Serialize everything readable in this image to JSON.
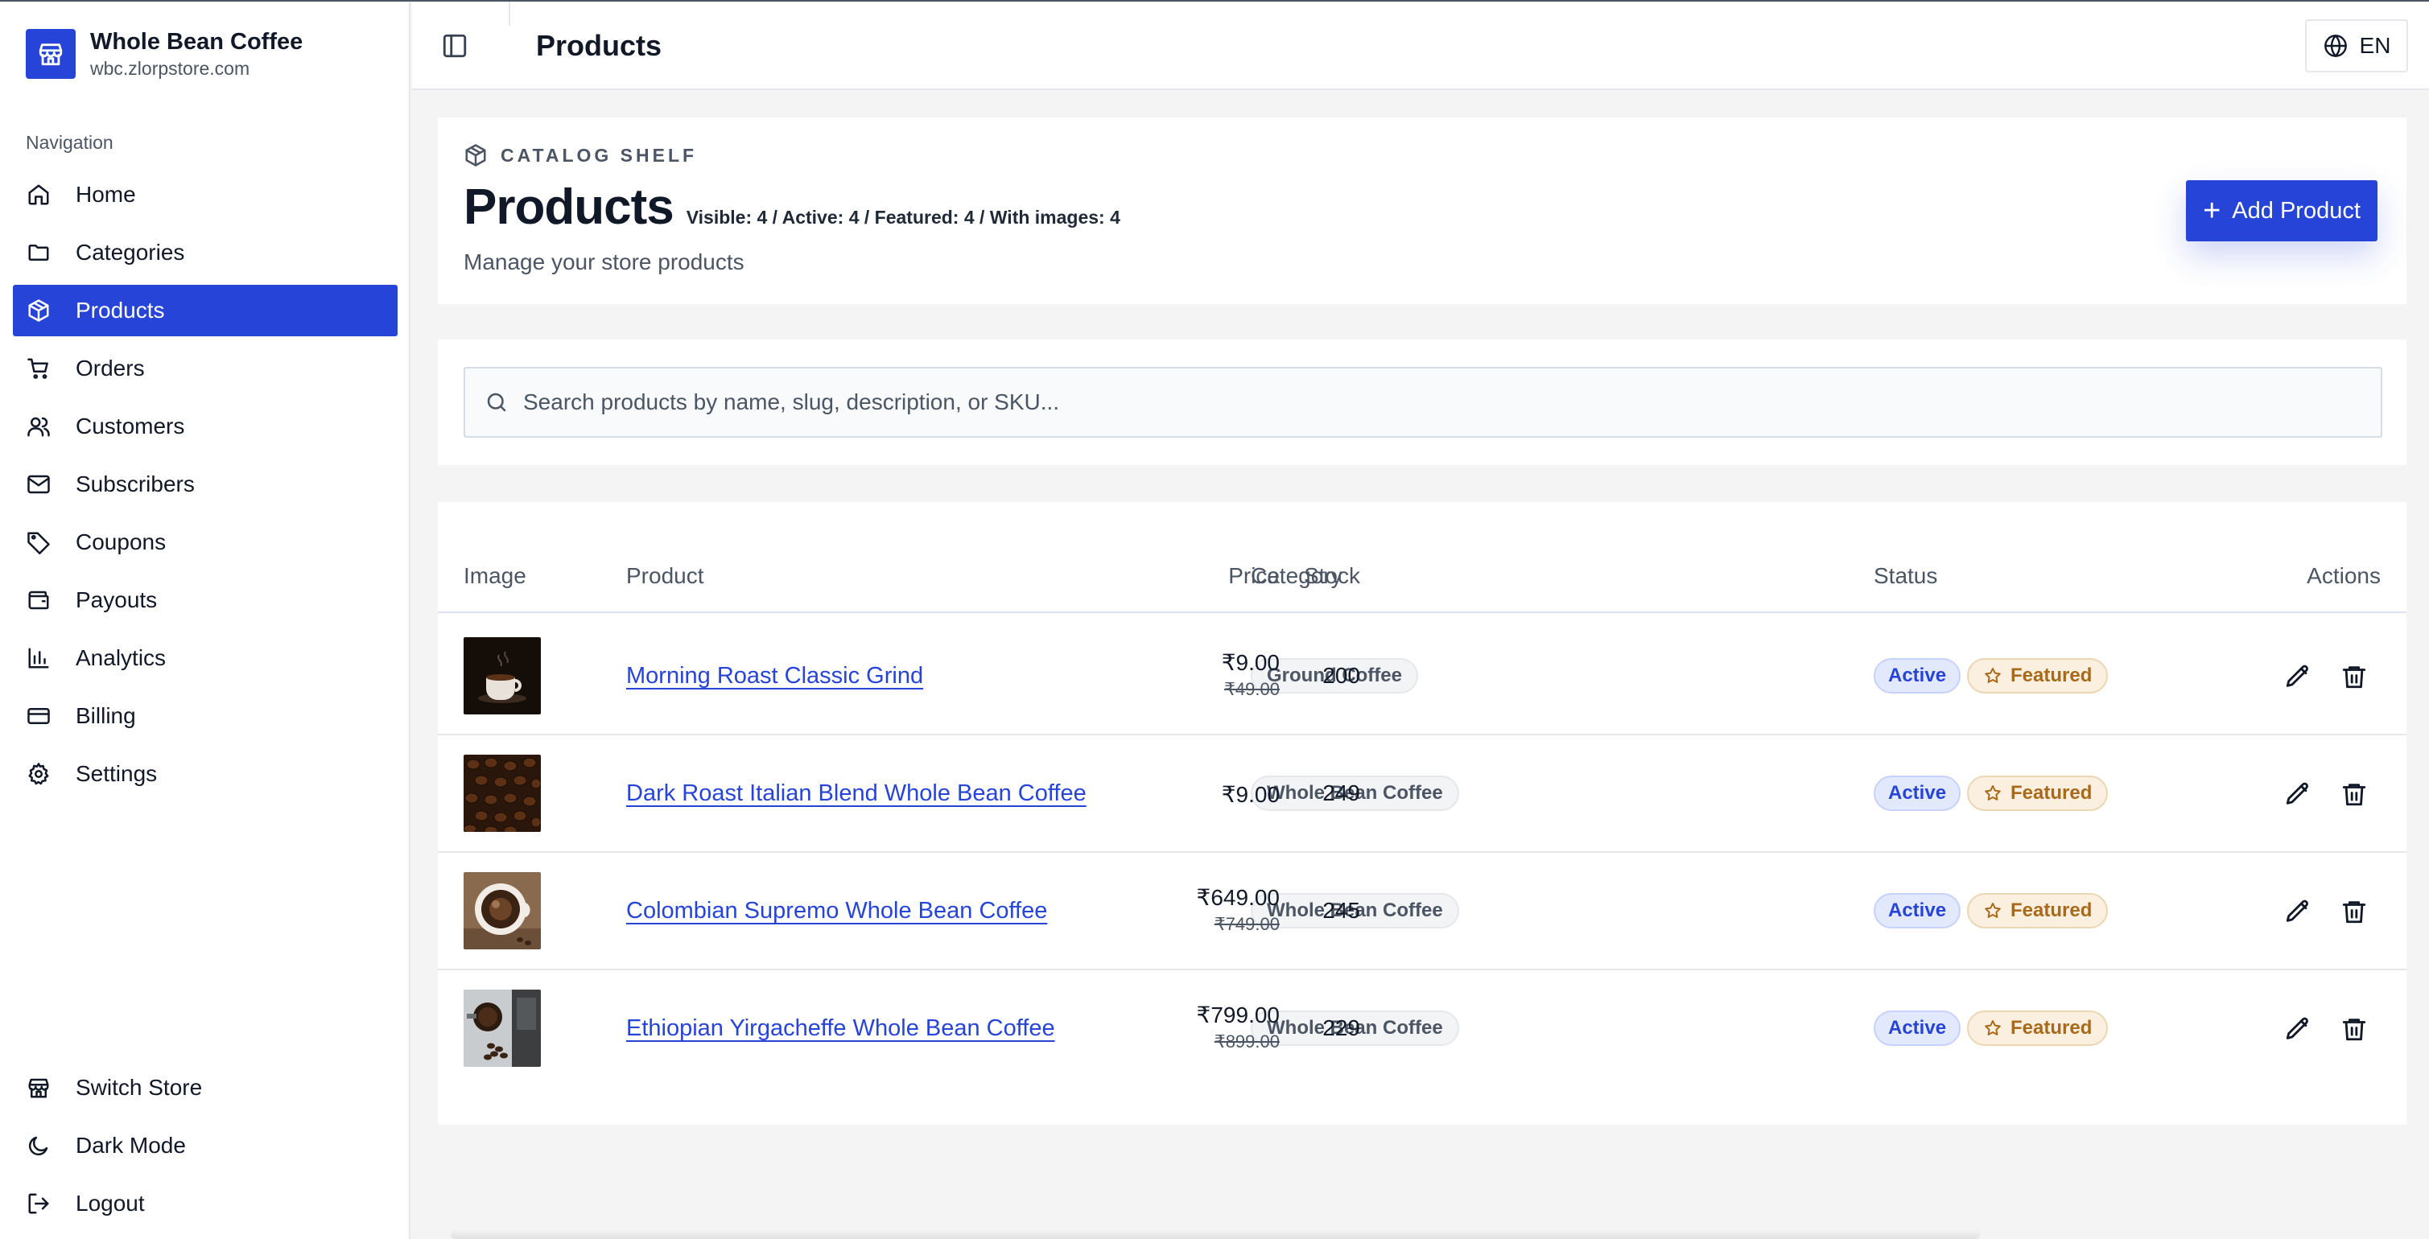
{
  "store": {
    "name": "Whole Bean Coffee",
    "domain": "wbc.zlorpstore.com"
  },
  "sidebar": {
    "heading": "Navigation",
    "items": [
      {
        "label": "Home",
        "icon": "home-icon"
      },
      {
        "label": "Categories",
        "icon": "folder-icon"
      },
      {
        "label": "Products",
        "icon": "package-icon",
        "active": true
      },
      {
        "label": "Orders",
        "icon": "cart-icon"
      },
      {
        "label": "Customers",
        "icon": "users-icon"
      },
      {
        "label": "Subscribers",
        "icon": "mail-icon"
      },
      {
        "label": "Coupons",
        "icon": "tag-icon"
      },
      {
        "label": "Payouts",
        "icon": "wallet-icon"
      },
      {
        "label": "Analytics",
        "icon": "bar-chart-icon"
      },
      {
        "label": "Billing",
        "icon": "credit-card-icon"
      },
      {
        "label": "Settings",
        "icon": "gear-icon"
      }
    ],
    "bottom": [
      {
        "label": "Switch Store",
        "icon": "store-icon"
      },
      {
        "label": "Dark Mode",
        "icon": "moon-icon"
      },
      {
        "label": "Logout",
        "icon": "logout-icon"
      }
    ]
  },
  "header": {
    "title": "Products",
    "language": "EN"
  },
  "page": {
    "eyebrow": "CATALOG SHELF",
    "title": "Products",
    "stats": "Visible: 4 / Active: 4 / Featured: 4 / With images: 4",
    "subtitle": "Manage your store products",
    "add_button": "Add Product"
  },
  "search": {
    "placeholder": "Search products by name, slug, description, or SKU...",
    "value": ""
  },
  "table": {
    "columns": {
      "image": "Image",
      "product": "Product",
      "category": "Category",
      "price": "Price",
      "stock": "Stock",
      "status": "Status",
      "actions": "Actions"
    },
    "rows": [
      {
        "name": "Morning Roast Classic Grind",
        "category": "Ground Coffee",
        "price": "₹9.00",
        "old_price": "₹49.00",
        "stock": "200",
        "status": "Active",
        "featured": "Featured",
        "thumb": "coffee-cup"
      },
      {
        "name": "Dark Roast Italian Blend Whole Bean Coffee",
        "category": "Whole Bean Coffee",
        "price": "₹9.00",
        "old_price": "",
        "stock": "249",
        "status": "Active",
        "featured": "Featured",
        "thumb": "beans"
      },
      {
        "name": "Colombian Supremo Whole Bean Coffee",
        "category": "Whole Bean Coffee",
        "price": "₹649.00",
        "old_price": "₹749.00",
        "stock": "245",
        "status": "Active",
        "featured": "Featured",
        "thumb": "mug-top"
      },
      {
        "name": "Ethiopian Yirgacheffe Whole Bean Coffee",
        "category": "Whole Bean Coffee",
        "price": "₹799.00",
        "old_price": "₹899.00",
        "stock": "229",
        "status": "Active",
        "featured": "Featured",
        "thumb": "grinder"
      }
    ]
  },
  "colors": {
    "accent": "#2744d8",
    "featured": "#a86a18",
    "active_bg": "#e3e9fc"
  }
}
